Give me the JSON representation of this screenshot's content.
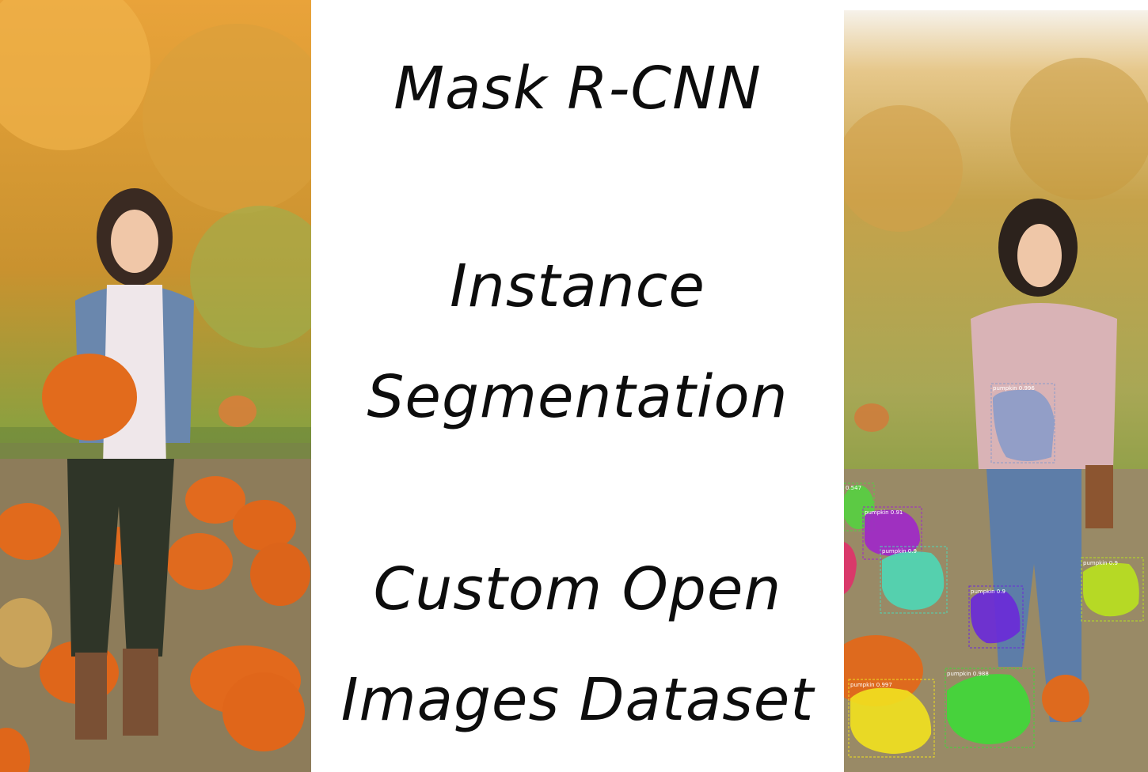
{
  "title_lines": [
    "Mask R-CNN",
    "Instance",
    "Segmentation",
    "Custom Open",
    "Images Dataset"
  ],
  "images": {
    "left": "woman-holding-pumpkin-original",
    "right": "woman-holding-pumpkin-segmented"
  },
  "detections": [
    {
      "label": "pumpkin 0.996",
      "color": "#8a9bc9"
    },
    {
      "label": "0.547",
      "color": "#55d040"
    },
    {
      "label": "pumpkin 0.91",
      "color": "#a028c8"
    },
    {
      "label": "pumpkin 0.9",
      "color": "#4fd6b4"
    },
    {
      "label": "pumpkin 0.9",
      "color": "#6a2ad8"
    },
    {
      "label": "pumpkin 0.9",
      "color": "#b8e020"
    },
    {
      "label": "pumpkin 0.988",
      "color": "#40d838"
    },
    {
      "label": "pumpkin 0.997",
      "color": "#f0e020"
    },
    {
      "label": "",
      "color": "#e0306a"
    }
  ]
}
